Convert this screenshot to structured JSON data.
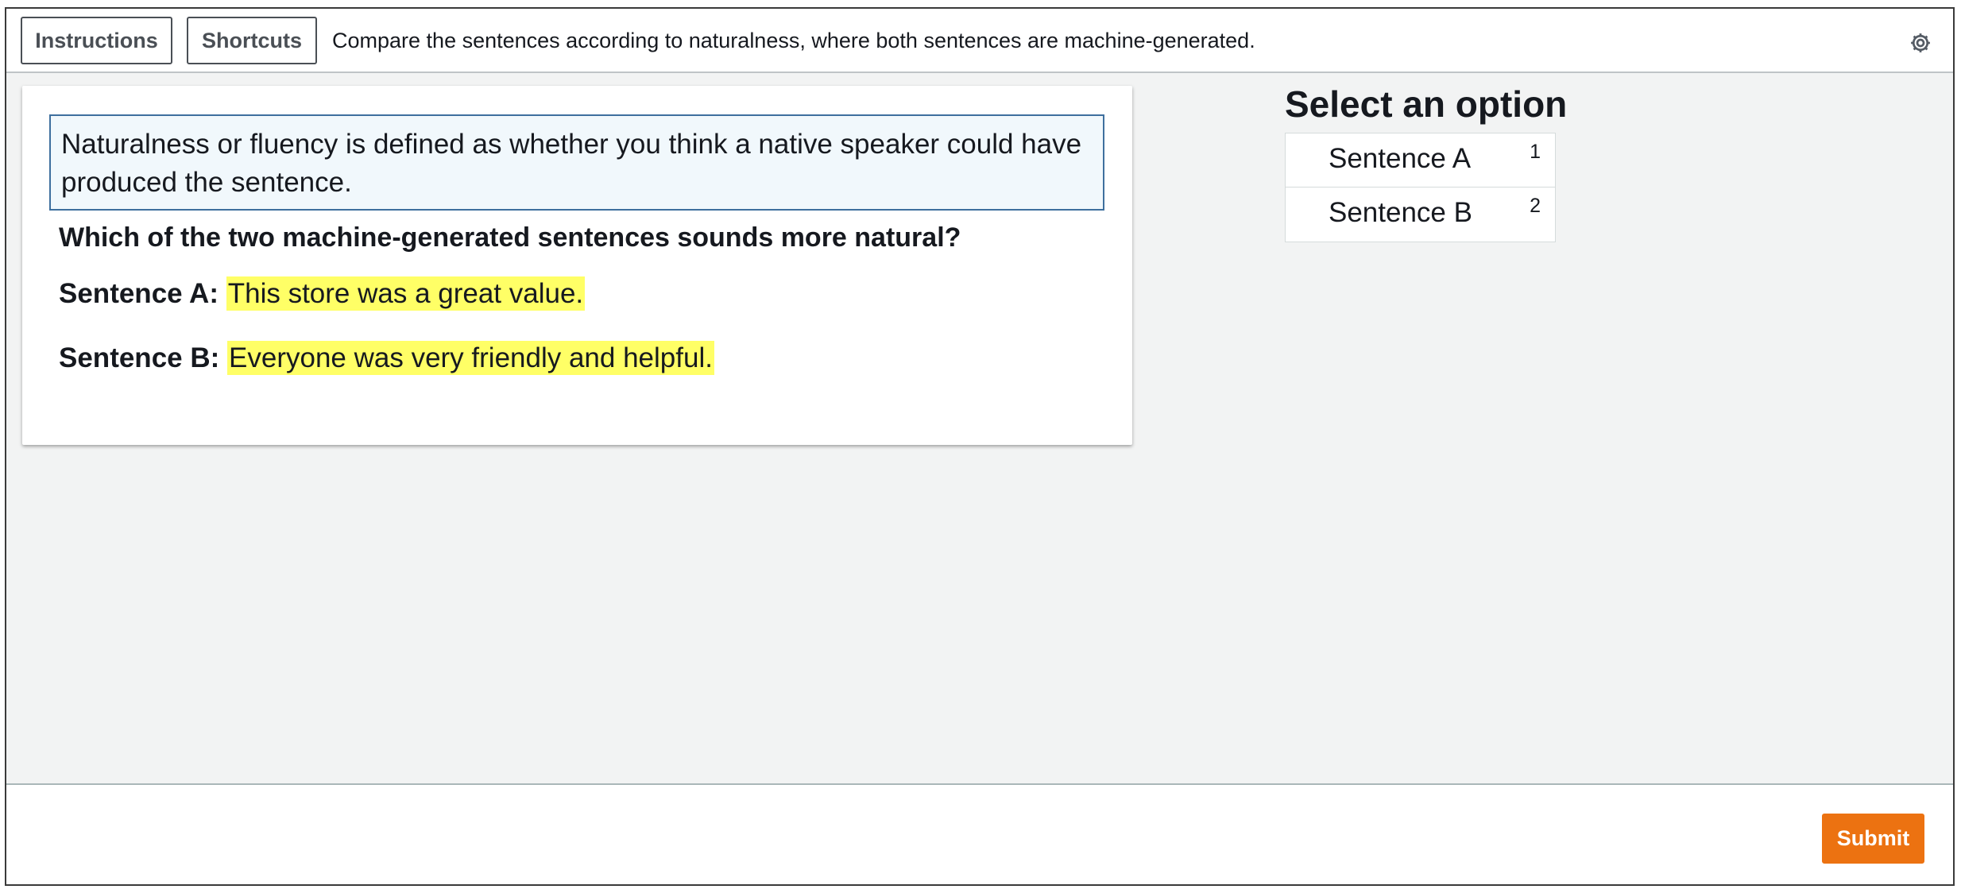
{
  "topbar": {
    "instructions_label": "Instructions",
    "shortcuts_label": "Shortcuts",
    "task_description": "Compare the sentences according to naturalness, where both sentences are machine-generated.",
    "settings_icon": "gear-icon"
  },
  "card": {
    "definition": "Naturalness or fluency is defined as whether you think a native speaker could have produced the sentence.",
    "question": "Which of the two machine-generated sentences sounds more natural?",
    "sentence_a_label": "Sentence A:",
    "sentence_a_text": "This store was a great value.",
    "sentence_b_label": "Sentence B:",
    "sentence_b_text": "Everyone was very friendly and helpful."
  },
  "options": {
    "title": "Select an option",
    "items": [
      {
        "label": "Sentence A",
        "shortcut": "1"
      },
      {
        "label": "Sentence B",
        "shortcut": "2"
      }
    ]
  },
  "footer": {
    "submit_label": "Submit"
  },
  "colors": {
    "highlight": "#ffff66",
    "submit": "#ec7211",
    "definition_border": "#3e6f9e",
    "workspace_bg": "#f2f3f3"
  }
}
